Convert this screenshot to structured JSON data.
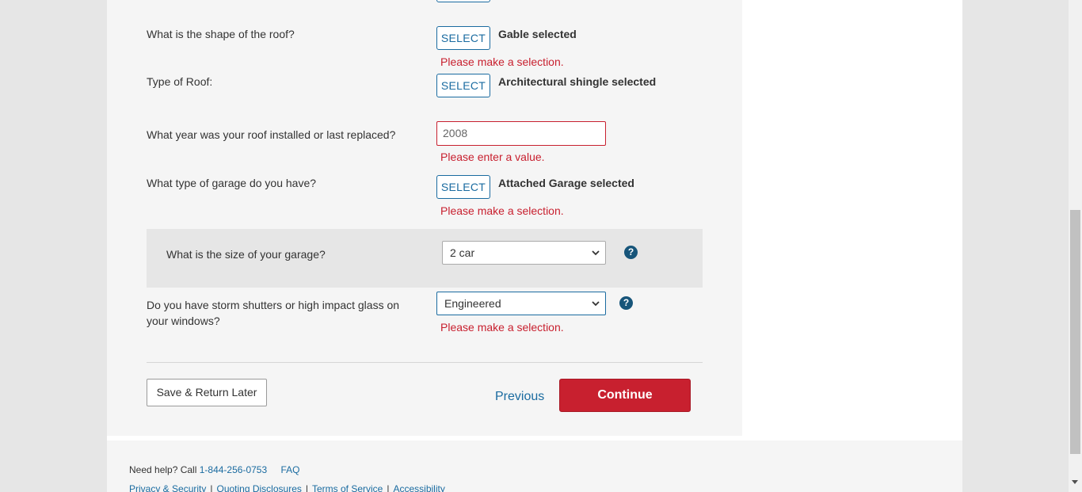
{
  "form": {
    "roof_shape": {
      "question": "What is the shape of the roof?",
      "button_label": "SELECT",
      "selected": "Gable selected",
      "error": "Please make a selection."
    },
    "roof_type": {
      "question": "Type of Roof:",
      "button_label": "SELECT",
      "selected": "Architectural shingle selected"
    },
    "roof_year": {
      "question": "What year was your roof installed or last replaced?",
      "value": "2008",
      "error": "Please enter a value."
    },
    "garage_type": {
      "question": "What type of garage do you have?",
      "button_label": "SELECT",
      "selected": "Attached Garage selected",
      "error": "Please make a selection."
    },
    "garage_size": {
      "question": "What is the size of your garage?",
      "value": "2 car",
      "help": "?"
    },
    "storm_shutters": {
      "question_line1": "Do you have storm shutters or high impact glass on",
      "question_line2": "your windows?",
      "value": "Engineered",
      "help": "?",
      "error": "Please make a selection."
    }
  },
  "actions": {
    "save_label": "Save & Return Later",
    "previous_label": "Previous",
    "continue_label": "Continue"
  },
  "footer": {
    "help_prefix": "Need help? Call",
    "phone": "1-844-256-0753",
    "faq": "FAQ",
    "links": [
      "Privacy & Security",
      "Quoting Disclosures",
      "Terms of Service",
      "Accessibility"
    ],
    "separator": "|"
  },
  "colors": {
    "brand_red": "#c8202f",
    "link_blue": "#1a6ba0",
    "help_icon": "#17557a"
  }
}
